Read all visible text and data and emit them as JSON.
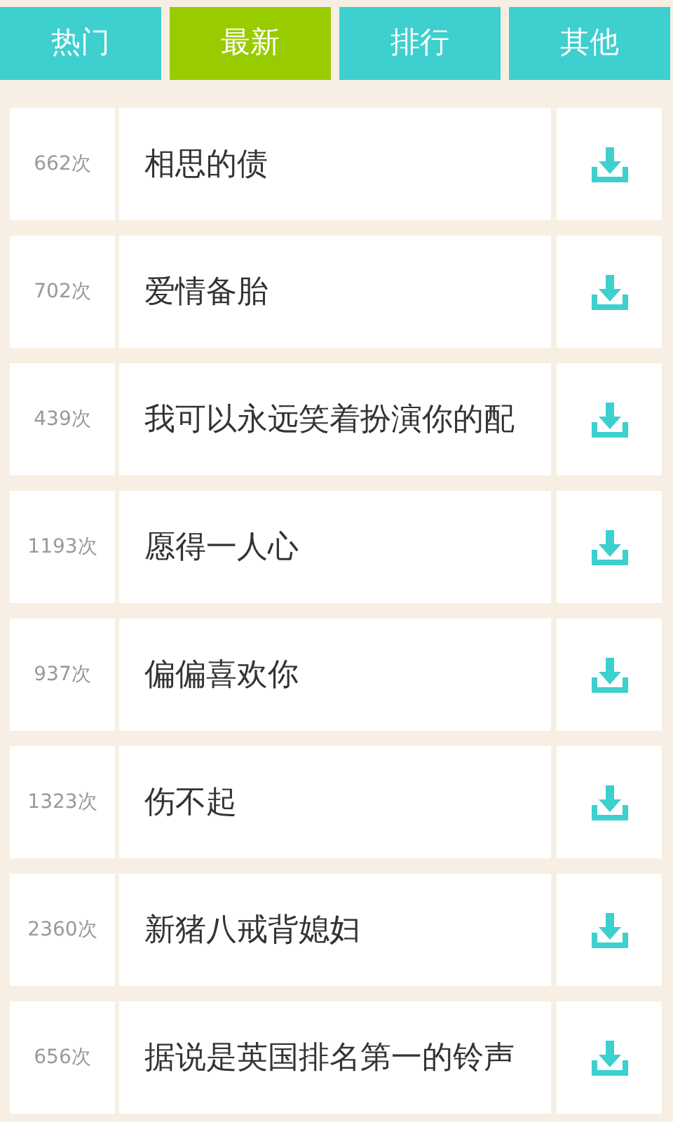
{
  "tabs": [
    {
      "label": "热门",
      "selected": false
    },
    {
      "label": "最新",
      "selected": true
    },
    {
      "label": "排行",
      "selected": false
    },
    {
      "label": "其他",
      "selected": false
    }
  ],
  "songs": [
    {
      "count": "662次",
      "title": "相思的债"
    },
    {
      "count": "702次",
      "title": "爱情备胎"
    },
    {
      "count": "439次",
      "title": "我可以永远笑着扮演你的配"
    },
    {
      "count": "1193次",
      "title": "愿得一人心"
    },
    {
      "count": "937次",
      "title": "偏偏喜欢你"
    },
    {
      "count": "1323次",
      "title": "伤不起"
    },
    {
      "count": "2360次",
      "title": "新猪八戒背媳妇"
    },
    {
      "count": "656次",
      "title": "据说是英国排名第一的铃声"
    }
  ]
}
